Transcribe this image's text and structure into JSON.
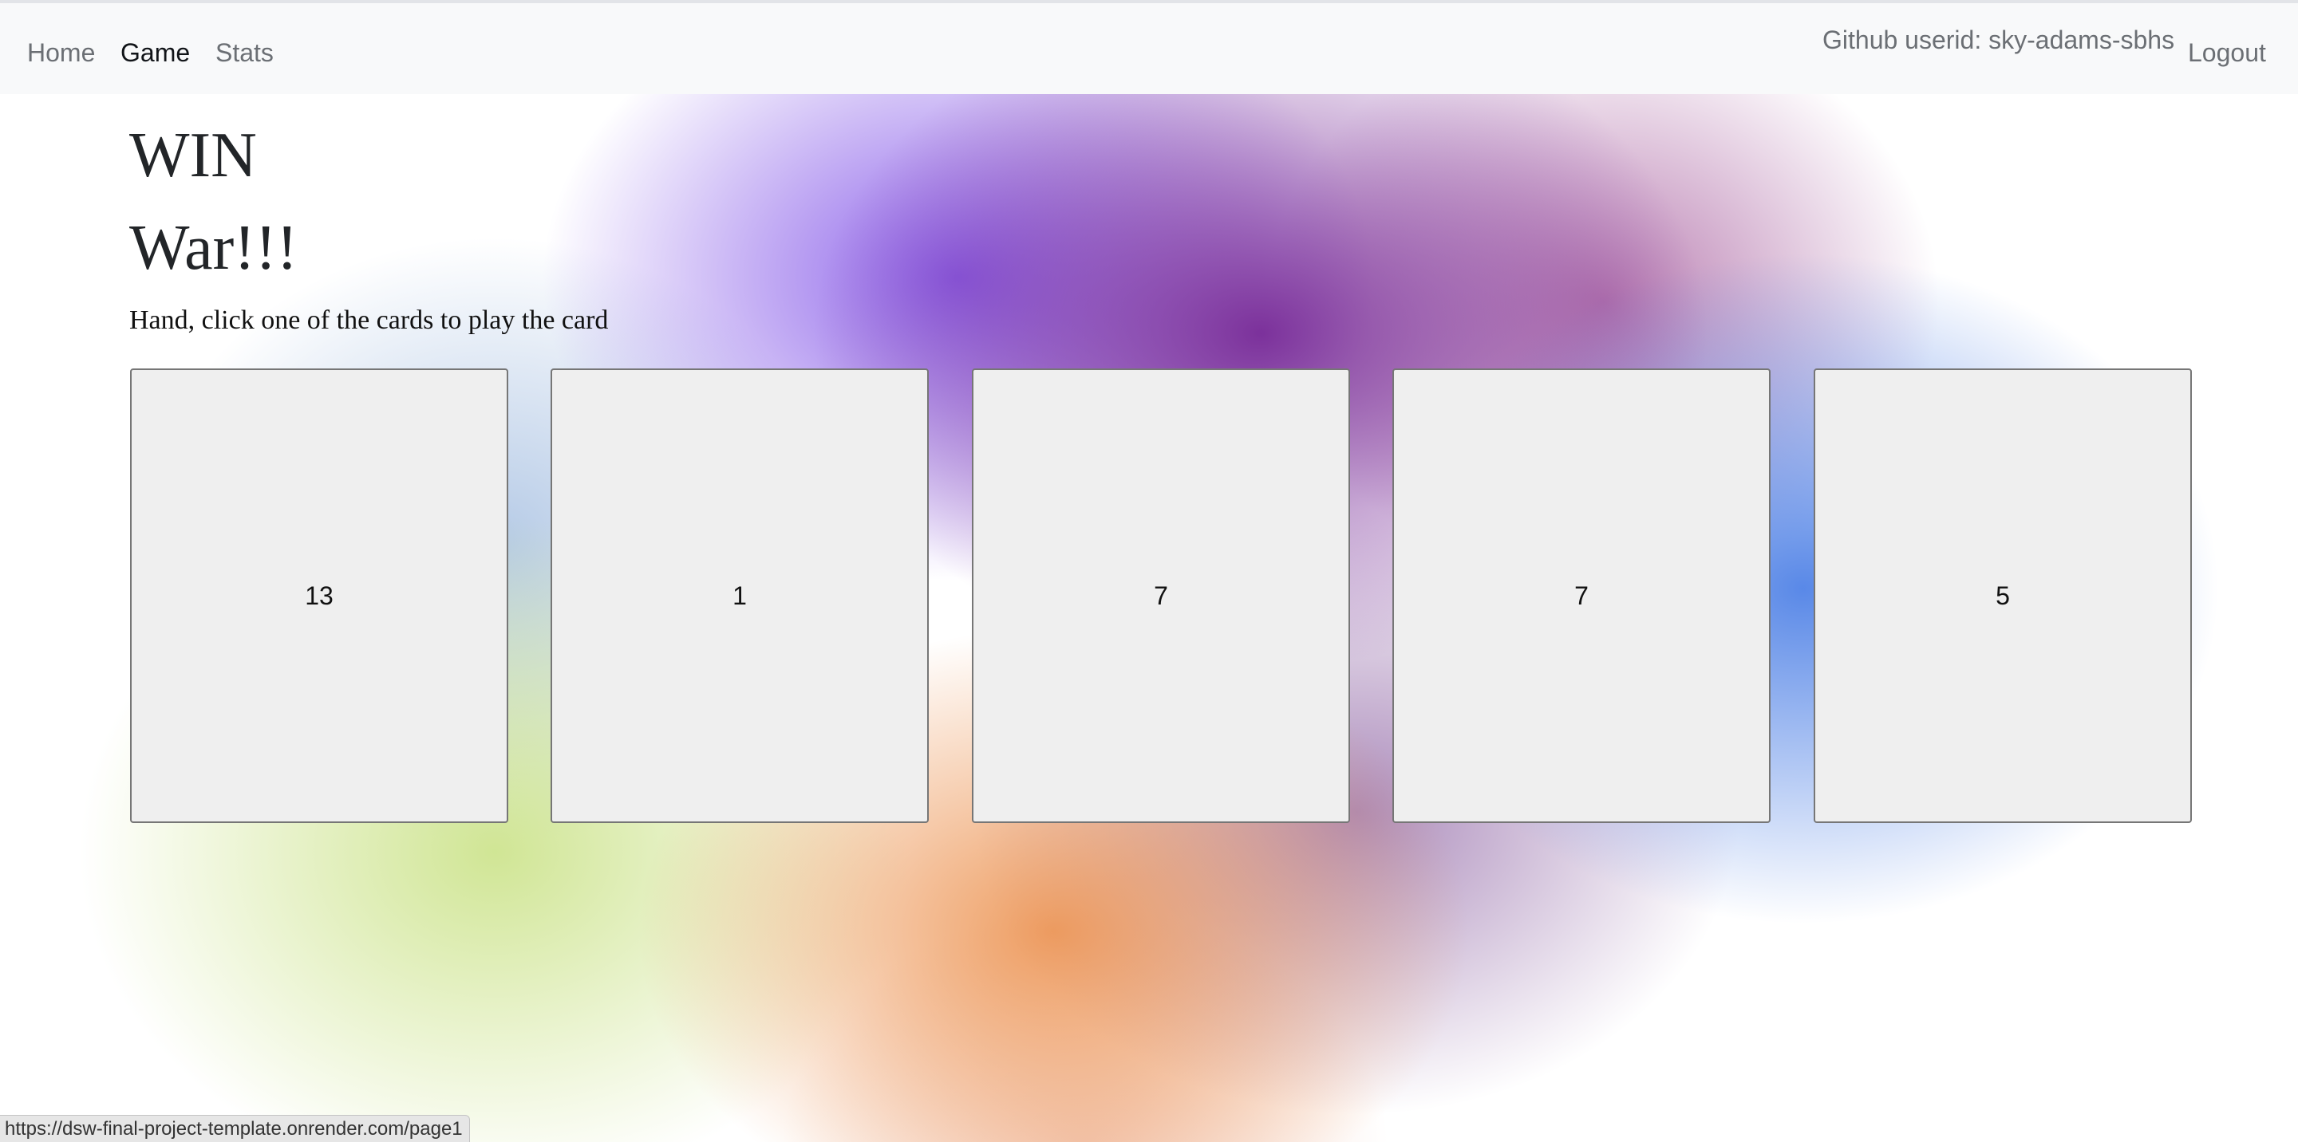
{
  "navbar": {
    "home_label": "Home",
    "game_label": "Game",
    "stats_label": "Stats",
    "user_label": "Github userid: sky-adams-sbhs",
    "logout_label": "Logout"
  },
  "main": {
    "result_title": "WIN",
    "game_title": "War!!!",
    "instructions": "Hand, click one of the cards to play the card",
    "cards": [
      {
        "value": "13"
      },
      {
        "value": "1"
      },
      {
        "value": "7"
      },
      {
        "value": "7"
      },
      {
        "value": "5"
      }
    ]
  },
  "status_bar": {
    "url": "https://dsw-final-project-template.onrender.com/page1"
  }
}
